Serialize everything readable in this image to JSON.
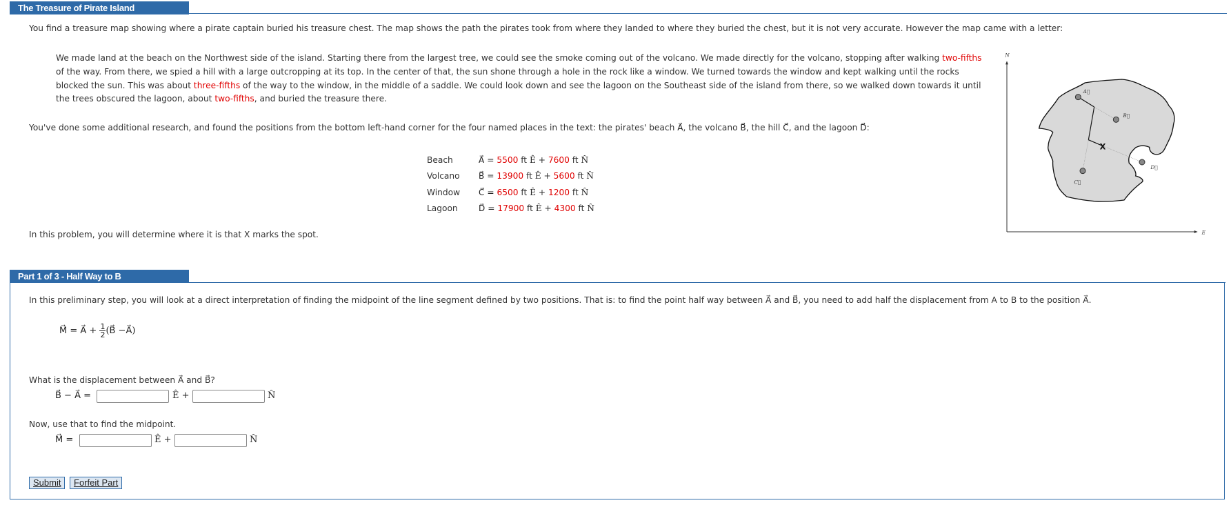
{
  "header": {
    "title": "The Treasure of Pirate Island"
  },
  "intro": "You find a treasure map showing where a pirate captain buried his treasure chest. The map shows the path the pirates took from where they landed to where they buried the chest, but it is not very accurate. However the map came with a letter:",
  "letter": {
    "s1": "We made land at the beach on the Northwest side of the island. Starting there from the largest tree, we could see the smoke coming out of the volcano. We made directly for the volcano, stopping after walking ",
    "h1": "two-fifths",
    "s2": " of the way. From there, we spied a hill with a large outcropping at its top. In the center of that, the sun shone through a hole in the rock like a window. We turned towards the window and kept walking until the rocks blocked the sun. This was about ",
    "h2": "three-fifths",
    "s3": " of the way to the window, in the middle of a saddle. We could look down and see the lagoon on the Southeast side of the island from there, so we walked down towards it until the trees obscured the lagoon, about ",
    "h3": "two-fifths",
    "s4": ", and buried the treasure there."
  },
  "research": {
    "text": "You've done some additional research, and found the positions from the bottom left-hand corner for the four named places in the text: the pirates' beach ",
    "a": "A⃗",
    "t1": ", the volcano ",
    "b": "B⃗",
    "t2": ", the hill ",
    "c": "C⃗",
    "t3": ", and the lagoon ",
    "d": "D⃗",
    "t4": ":"
  },
  "positions": [
    {
      "label": "Beach",
      "vec": "A⃗",
      "east": "5500",
      "north": "7600"
    },
    {
      "label": "Volcano",
      "vec": "B⃗",
      "east": "13900",
      "north": "5600"
    },
    {
      "label": "Window",
      "vec": "C⃗",
      "east": "6500",
      "north": "1200"
    },
    {
      "label": "Lagoon",
      "vec": "D⃗",
      "east": "17900",
      "north": "4300"
    }
  ],
  "units": {
    "eq": "=",
    "ft": "ft",
    "E": "Ê",
    "plus": "+",
    "N": "N̂"
  },
  "problem": "In this problem, you will determine where it is that X marks the spot.",
  "map": {
    "north_label": "N",
    "east_label": "E",
    "a": "A⃗",
    "b": "B⃗",
    "c": "C⃗",
    "d": "D⃗",
    "x": "X"
  },
  "part1": {
    "title": "Part 1 of 3 - Half Way to B",
    "description": "In this preliminary step, you will look at a direct interpretation of finding the midpoint of the line segment defined by two positions. That is: to find the point half way between A⃗ and B⃗, you need to add half the displacement from A to B to the position A⃗.",
    "formula": {
      "lhs": "M⃗ = A⃗ + ",
      "num": "1",
      "den": "2",
      "rhs": "(B⃗ −A⃗)"
    },
    "q1": "What is the displacement between A⃗ and B⃗?",
    "q1_lhs": "B⃗ − A⃗ =",
    "q1_east": "",
    "q1_north": "",
    "q2": "Now, use that to find the midpoint.",
    "q2_lhs": "M⃗ =",
    "q2_east": "",
    "q2_north": "",
    "submit": "Submit",
    "forfeit": "Forfeit Part"
  },
  "colors": {
    "accent": "#2e6aa8",
    "highlight": "#e00000",
    "island": "#d9d9d9"
  }
}
